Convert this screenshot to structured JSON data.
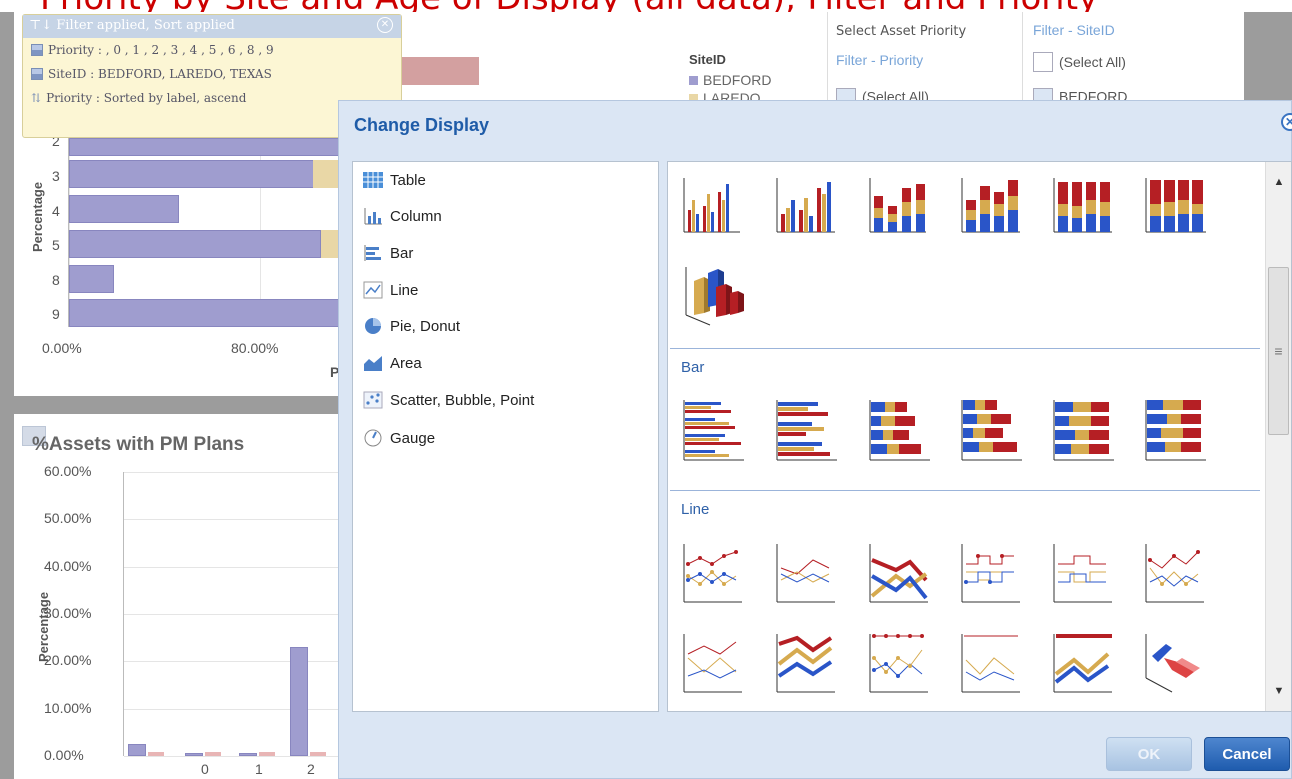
{
  "title_strip_text": "Priority by Site and Age of Display (all data); Filter and Priority",
  "filter_tooltip": {
    "header": "Filter applied, Sort applied",
    "rows": [
      "Priority : , 0 , 1 , 2 , 3 , 4 , 5 , 6 , 8 , 9",
      "SiteID : BEDFORD, LAREDO, TEXAS",
      "Priority : Sorted by label, ascend"
    ]
  },
  "legend": {
    "title": "SiteID",
    "items": [
      "BEDFORD",
      "LAREDO"
    ]
  },
  "priority_filter": {
    "heading": "Select Asset Priority",
    "subheading": "Filter - Priority",
    "select_all": "(Select All)"
  },
  "site_filter": {
    "heading": "Filter - SiteID",
    "select_all": "(Select All)",
    "first_item": "BEDFORD"
  },
  "top_chart": {
    "ylabel": "Percentage",
    "categories": [
      "2",
      "3",
      "4",
      "5",
      "8",
      "9"
    ],
    "xticks": [
      "0.00%",
      "80.00%"
    ],
    "xaxis_partial": "P"
  },
  "bottom_chart": {
    "title": "%Assets with PM Plans",
    "ylabel": "Percentage",
    "yticks": [
      "60.00%",
      "50.00%",
      "40.00%",
      "30.00%",
      "20.00%",
      "10.00%",
      "0.00%"
    ],
    "xticks": [
      "0",
      "1",
      "2"
    ]
  },
  "chart_data": [
    {
      "type": "bar",
      "orientation": "horizontal",
      "categories": [
        "3",
        "4",
        "5",
        "8",
        "9"
      ],
      "series": [
        {
          "values": [
            94,
            43,
            96,
            16,
            100
          ]
        }
      ],
      "xlim": [
        0,
        100
      ]
    },
    {
      "type": "bar",
      "title": "%Assets with PM Plans",
      "ylabel": "Percentage",
      "categories": [
        ",",
        "0",
        "1",
        "2"
      ],
      "series": [
        {
          "values": [
            2.5,
            0.3,
            0.3,
            23
          ]
        }
      ],
      "ylim": [
        0,
        60
      ]
    }
  ],
  "dialog": {
    "title": "Change Display",
    "chart_types": [
      {
        "label": "Table",
        "icon": "table-icon"
      },
      {
        "label": "Column",
        "icon": "column-chart-icon"
      },
      {
        "label": "Bar",
        "icon": "bar-chart-icon"
      },
      {
        "label": "Line",
        "icon": "line-chart-icon"
      },
      {
        "label": "Pie, Donut",
        "icon": "pie-chart-icon"
      },
      {
        "label": "Area",
        "icon": "area-chart-icon"
      },
      {
        "label": "Scatter, Bubble, Point",
        "icon": "scatter-chart-icon"
      },
      {
        "label": "Gauge",
        "icon": "gauge-icon"
      }
    ],
    "sections": {
      "bar": "Bar",
      "line": "Line"
    },
    "ok_label": "OK",
    "cancel_label": "Cancel"
  },
  "colors": {
    "series_primary": "#9f9dcf",
    "accent": "#1f5ca8",
    "red": "#b51f24",
    "gold": "#d6aa4f",
    "blue": "#2a55c8"
  }
}
